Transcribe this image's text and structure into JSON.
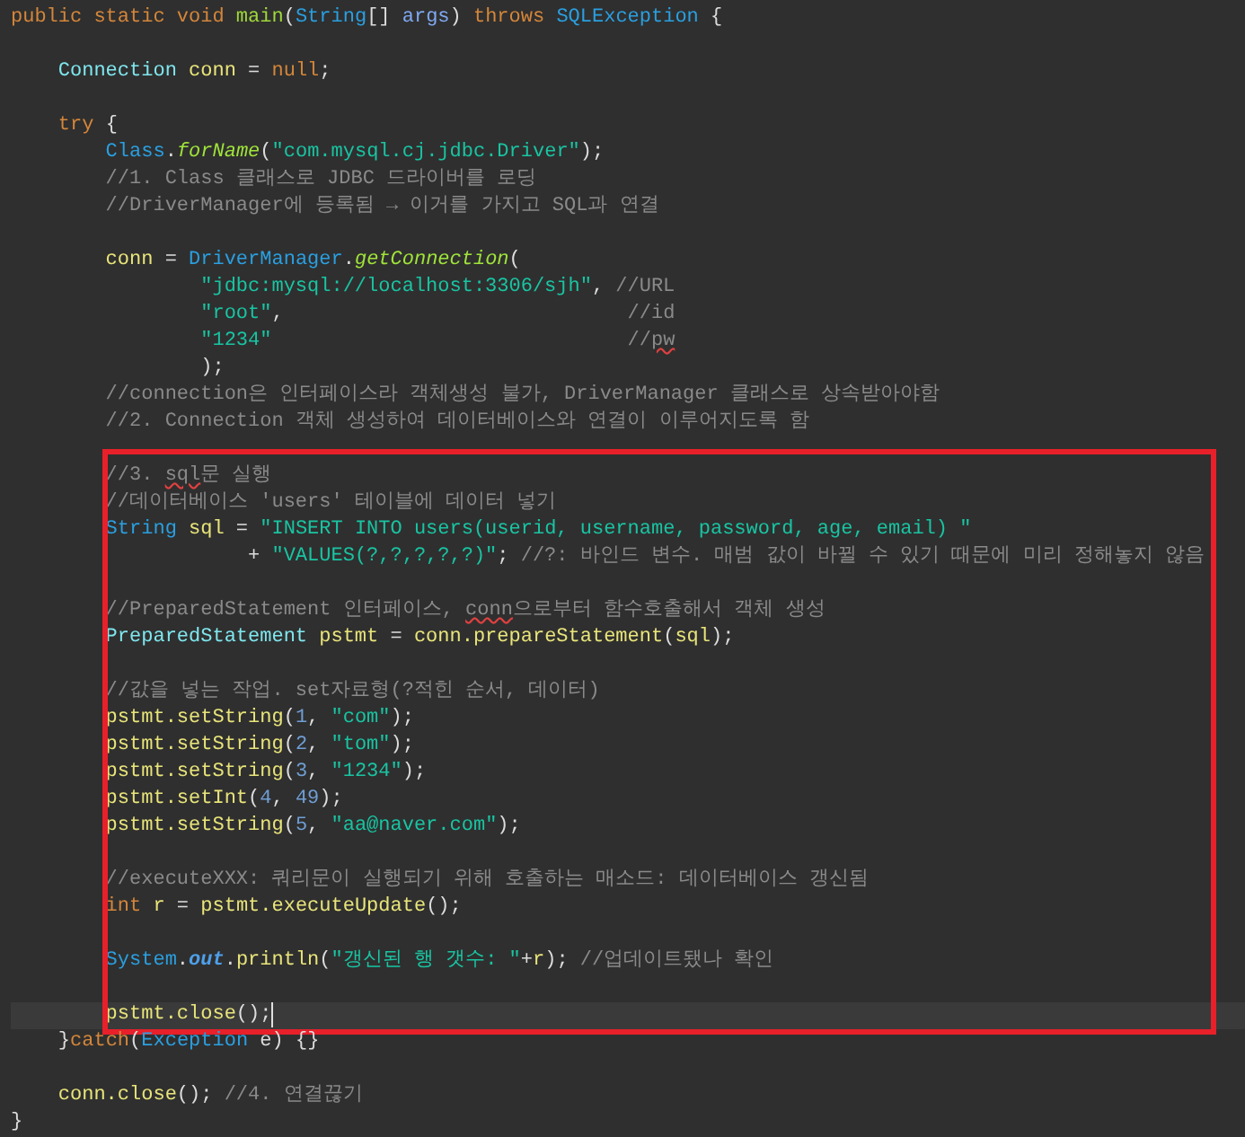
{
  "editor": {
    "blocks": [
      {
        "framed": false,
        "lines": [
          {
            "current": false,
            "tokens": [
              {
                "kind": "keyword",
                "text": "public static void"
              },
              {
                "kind": "declaration",
                "text": " main"
              },
              {
                "kind": "plain",
                "text": "("
              },
              {
                "kind": "type",
                "text": "String"
              },
              {
                "kind": "plain",
                "text": "[] "
              },
              {
                "kind": "parameter",
                "text": "args"
              },
              {
                "kind": "plain",
                "text": ") "
              },
              {
                "kind": "keyword",
                "text": "throws"
              },
              {
                "kind": "type",
                "text": " SQLException"
              },
              {
                "kind": "plain",
                "text": " {"
              }
            ]
          },
          {
            "current": false
          },
          {
            "current": false,
            "tokens": [
              {
                "kind": "interface",
                "text": "    Connection"
              },
              {
                "kind": "variable",
                "text": " conn"
              },
              {
                "kind": "plain",
                "text": " = "
              },
              {
                "kind": "keyword",
                "text": "null"
              },
              {
                "kind": "plain",
                "text": ";"
              }
            ]
          },
          {
            "current": false
          },
          {
            "current": false,
            "tokens": [
              {
                "kind": "keyword",
                "text": "    try"
              },
              {
                "kind": "plain",
                "text": " {"
              }
            ]
          },
          {
            "current": false,
            "tokens": [
              {
                "kind": "type",
                "text": "        Class"
              },
              {
                "kind": "plain",
                "text": "."
              },
              {
                "kind": "static_method",
                "text": "forName"
              },
              {
                "kind": "plain",
                "text": "("
              },
              {
                "kind": "string",
                "text": "\"com.mysql.cj.jdbc.Driver\""
              },
              {
                "kind": "plain",
                "text": ");"
              }
            ]
          },
          {
            "current": false,
            "tokens": [
              {
                "kind": "comment",
                "text": "        //1. Class 클래스로 JDBC 드라이버를 로딩"
              }
            ]
          },
          {
            "current": false,
            "tokens": [
              {
                "kind": "comment",
                "text": "        //DriverManager에 등록됨 → 이거를 가지고 SQL과 연결"
              }
            ]
          },
          {
            "current": false
          },
          {
            "current": false,
            "tokens": [
              {
                "kind": "variable",
                "text": "        conn"
              },
              {
                "kind": "plain",
                "text": " = "
              },
              {
                "kind": "type",
                "text": "DriverManager"
              },
              {
                "kind": "plain",
                "text": "."
              },
              {
                "kind": "static_method",
                "text": "getConnection"
              },
              {
                "kind": "plain",
                "text": "("
              }
            ]
          },
          {
            "current": false,
            "tokens": [
              {
                "kind": "string",
                "text": "                \"jdbc:mysql://localhost:3306/sjh\""
              },
              {
                "kind": "plain",
                "text": ", "
              },
              {
                "kind": "comment",
                "text": "//URL"
              }
            ]
          },
          {
            "current": false,
            "tokens": [
              {
                "kind": "string",
                "text": "                \"root\""
              },
              {
                "kind": "plain",
                "text": ","
              },
              {
                "kind": "comment",
                "text": "                             //id"
              }
            ]
          },
          {
            "current": false,
            "tokens": [
              {
                "kind": "string",
                "text": "                \"1234\""
              },
              {
                "kind": "comment",
                "text": "                              //"
              },
              {
                "kind": "misspelled_comment",
                "text": "pw"
              }
            ]
          },
          {
            "current": false,
            "tokens": [
              {
                "kind": "plain",
                "text": "                );"
              }
            ]
          },
          {
            "current": false,
            "tokens": [
              {
                "kind": "comment",
                "text": "        //connection은 인터페이스라 객체생성 불가, DriverManager 클래스로 상속받아야함"
              }
            ]
          },
          {
            "current": false,
            "tokens": [
              {
                "kind": "comment",
                "text": "        //2. Connection 객체 생성하여 데이터베이스와 연결이 이루어지도록 함"
              }
            ]
          }
        ]
      },
      {
        "framed": true,
        "lines": [
          {
            "current": false
          },
          {
            "current": false,
            "tokens": [
              {
                "kind": "comment",
                "text": "        //3. "
              },
              {
                "kind": "misspelled_comment",
                "text": "sql"
              },
              {
                "kind": "comment",
                "text": "문 실행"
              }
            ]
          },
          {
            "current": false,
            "tokens": [
              {
                "kind": "comment",
                "text": "        //데이터베이스 'users' 테이블에 데이터 넣기"
              }
            ]
          },
          {
            "current": false,
            "tokens": [
              {
                "kind": "type",
                "text": "        String"
              },
              {
                "kind": "variable",
                "text": " sql"
              },
              {
                "kind": "plain",
                "text": " = "
              },
              {
                "kind": "string",
                "text": "\"INSERT INTO users(userid, username, password, age, email) \""
              }
            ]
          },
          {
            "current": false,
            "tokens": [
              {
                "kind": "plain",
                "text": "                    + "
              },
              {
                "kind": "string",
                "text": "\"VALUES(?,?,?,?,?)\""
              },
              {
                "kind": "plain",
                "text": "; "
              },
              {
                "kind": "comment",
                "text": "//?: 바인드 변수. 매범 값이 바뀔 수 있기 때문에 미리 정해놓지 않음"
              }
            ]
          },
          {
            "current": false
          },
          {
            "current": false,
            "tokens": [
              {
                "kind": "comment",
                "text": "        //PreparedStatement 인터페이스, "
              },
              {
                "kind": "misspelled_comment",
                "text": "conn"
              },
              {
                "kind": "comment",
                "text": "으로부터 함수호출해서 객체 생성"
              }
            ]
          },
          {
            "current": false,
            "tokens": [
              {
                "kind": "interface",
                "text": "        PreparedStatement"
              },
              {
                "kind": "variable",
                "text": " pstmt"
              },
              {
                "kind": "plain",
                "text": " = "
              },
              {
                "kind": "variable",
                "text": "conn.prepareStatement"
              },
              {
                "kind": "plain",
                "text": "("
              },
              {
                "kind": "variable",
                "text": "sql"
              },
              {
                "kind": "plain",
                "text": ");"
              }
            ]
          },
          {
            "current": false
          },
          {
            "current": false,
            "tokens": [
              {
                "kind": "comment",
                "text": "        //값을 넣는 작업. set자료형(?적힌 순서, 데이터)"
              }
            ]
          },
          {
            "current": false,
            "tokens": [
              {
                "kind": "variable",
                "text": "        pstmt.setString"
              },
              {
                "kind": "plain",
                "text": "("
              },
              {
                "kind": "number",
                "text": "1"
              },
              {
                "kind": "plain",
                "text": ", "
              },
              {
                "kind": "string",
                "text": "\"com\""
              },
              {
                "kind": "plain",
                "text": ");"
              }
            ]
          },
          {
            "current": false,
            "tokens": [
              {
                "kind": "variable",
                "text": "        pstmt.setString"
              },
              {
                "kind": "plain",
                "text": "("
              },
              {
                "kind": "number",
                "text": "2"
              },
              {
                "kind": "plain",
                "text": ", "
              },
              {
                "kind": "string",
                "text": "\"tom\""
              },
              {
                "kind": "plain",
                "text": ");"
              }
            ]
          },
          {
            "current": false,
            "tokens": [
              {
                "kind": "variable",
                "text": "        pstmt.setString"
              },
              {
                "kind": "plain",
                "text": "("
              },
              {
                "kind": "number",
                "text": "3"
              },
              {
                "kind": "plain",
                "text": ", "
              },
              {
                "kind": "string",
                "text": "\"1234\""
              },
              {
                "kind": "plain",
                "text": ");"
              }
            ]
          },
          {
            "current": false,
            "tokens": [
              {
                "kind": "variable",
                "text": "        pstmt.setInt"
              },
              {
                "kind": "plain",
                "text": "("
              },
              {
                "kind": "number",
                "text": "4"
              },
              {
                "kind": "plain",
                "text": ", "
              },
              {
                "kind": "number",
                "text": "49"
              },
              {
                "kind": "plain",
                "text": ");"
              }
            ]
          },
          {
            "current": false,
            "tokens": [
              {
                "kind": "variable",
                "text": "        pstmt.setString"
              },
              {
                "kind": "plain",
                "text": "("
              },
              {
                "kind": "number",
                "text": "5"
              },
              {
                "kind": "plain",
                "text": ", "
              },
              {
                "kind": "string",
                "text": "\"aa@naver.com\""
              },
              {
                "kind": "plain",
                "text": ");"
              }
            ]
          },
          {
            "current": false
          },
          {
            "current": false,
            "tokens": [
              {
                "kind": "comment",
                "text": "        //executeXXX: 쿼리문이 실행되기 위해 호출하는 매소드: 데이터베이스 갱신됨"
              }
            ]
          },
          {
            "current": false,
            "tokens": [
              {
                "kind": "keyword",
                "text": "        int"
              },
              {
                "kind": "variable",
                "text": " r"
              },
              {
                "kind": "plain",
                "text": " = "
              },
              {
                "kind": "variable",
                "text": "pstmt.executeUpdate"
              },
              {
                "kind": "plain",
                "text": "();"
              }
            ]
          },
          {
            "current": false
          },
          {
            "current": false,
            "tokens": [
              {
                "kind": "type",
                "text": "        System"
              },
              {
                "kind": "plain",
                "text": "."
              },
              {
                "kind": "static_field",
                "text": "out"
              },
              {
                "kind": "plain",
                "text": "."
              },
              {
                "kind": "variable",
                "text": "println"
              },
              {
                "kind": "plain",
                "text": "("
              },
              {
                "kind": "string",
                "text": "\"갱신된 행 갯수: \""
              },
              {
                "kind": "plain",
                "text": "+"
              },
              {
                "kind": "variable",
                "text": "r"
              },
              {
                "kind": "plain",
                "text": "); "
              },
              {
                "kind": "comment",
                "text": "//업데이트됐나 확인"
              }
            ]
          },
          {
            "current": false
          },
          {
            "current": true,
            "tokens": [
              {
                "kind": "variable",
                "text": "        pstmt.close"
              },
              {
                "kind": "plain",
                "text": "();"
              }
            ]
          }
        ]
      },
      {
        "framed": false,
        "lines": [
          {
            "current": false,
            "tokens": [
              {
                "kind": "plain",
                "text": "    }"
              },
              {
                "kind": "keyword",
                "text": "catch"
              },
              {
                "kind": "plain",
                "text": "("
              },
              {
                "kind": "type",
                "text": "Exception"
              },
              {
                "kind": "plain",
                "text": " e) {}"
              }
            ]
          },
          {
            "current": false
          },
          {
            "current": false,
            "tokens": [
              {
                "kind": "variable",
                "text": "    conn.close"
              },
              {
                "kind": "plain",
                "text": "(); "
              },
              {
                "kind": "comment",
                "text": "//4. 연결끊기"
              }
            ]
          },
          {
            "current": false,
            "tokens": [
              {
                "kind": "plain",
                "text": "}"
              }
            ]
          }
        ]
      }
    ]
  }
}
